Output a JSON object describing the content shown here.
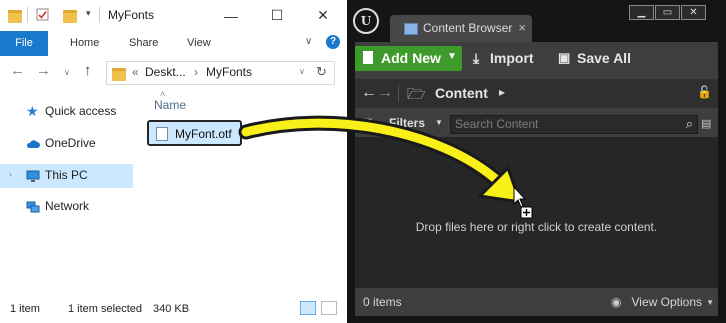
{
  "explorer": {
    "title": "MyFonts",
    "ribbon_tabs": [
      "File",
      "Home",
      "Share",
      "View"
    ],
    "address": {
      "overflow": "«",
      "parts": [
        "Deskt...",
        "MyFonts"
      ],
      "separator": "›"
    },
    "nav_items": [
      {
        "label": "Quick access",
        "icon": "star-icon"
      },
      {
        "label": "OneDrive",
        "icon": "cloud-icon"
      },
      {
        "label": "This PC",
        "icon": "computer-icon"
      },
      {
        "label": "Network",
        "icon": "network-icon"
      }
    ],
    "column_header": "Name",
    "file": {
      "name": "MyFont.otf",
      "icon": "font-file-icon"
    },
    "status": {
      "items": "1 item",
      "selected": "1 item selected",
      "size": "340 KB"
    },
    "window_buttons": [
      "—",
      "☐",
      "✕"
    ],
    "help": "?"
  },
  "unreal": {
    "logo": "U",
    "tab_title": "Content Browser",
    "tab_close": "×",
    "window_buttons": [
      "▁",
      "▭",
      "✕"
    ],
    "toolbar": {
      "add_new": "Add New",
      "import": "Import",
      "save_all": "Save All"
    },
    "nav": {
      "back": "←",
      "forward": "→",
      "crumb": "Content",
      "crumb_arrow": "▸"
    },
    "filters": "Filters",
    "search_placeholder": "Search Content",
    "drop_text": "Drop files here or right click to create content.",
    "items_count": "0 items",
    "view_options": "View Options"
  },
  "colors": {
    "explorer_accent": "#1979ca",
    "selection": "#cce8ff",
    "ue_green": "#3f9a2c",
    "arrow": "#f9f01a"
  }
}
